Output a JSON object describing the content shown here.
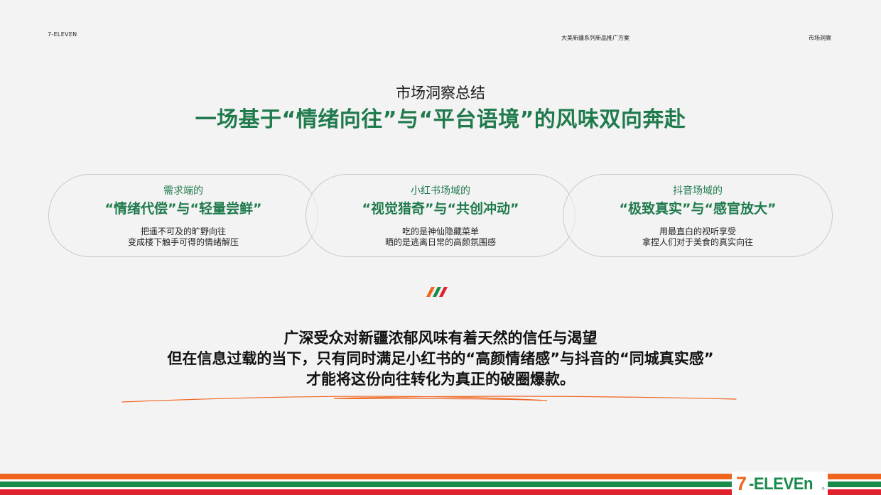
{
  "header": {
    "brand": "7-ELEVEN",
    "project": "大美新疆系列新品推广方案",
    "section": "市场洞察"
  },
  "page": {
    "subtitle": "市场洞察总结",
    "title": "一场基于“情绪向往”与“平台语境”的风味双向奔赴"
  },
  "pills": [
    {
      "label": "需求端的",
      "headline": "“情绪代偿”与“轻量尝鲜”",
      "line1": "把遥不可及的旷野向往",
      "line2": "变成楼下触手可得的情绪解压"
    },
    {
      "label": "小红书场域的",
      "headline": "“视觉猎奇”与“共创冲动”",
      "line1": "吃的是神仙隐藏菜单",
      "line2": "晒的是逃离日常的高颜氛围感"
    },
    {
      "label": "抖音场域的",
      "headline": "“极致真实”与“感官放大”",
      "line1": "用最直白的视听享受",
      "line2": "拿捏人们对于美食的真实向往"
    }
  ],
  "statement": {
    "line1": "广深受众对新疆浓郁风味有着天然的信任与渴望",
    "line2": "但在信息过载的当下，只有同时满足小红书的“高颜情绪感”与抖音的“同城真实感”",
    "line3": "才能将这份向往转化为真正的破圈爆款。"
  },
  "footer_logo": {
    "seven": "7",
    "rest": "-ELEVEn",
    "mark": "®"
  },
  "colors": {
    "brand_green": "#1f7a4c",
    "orange": "#f0641e",
    "green": "#1a8a4a",
    "red": "#e0202c"
  }
}
